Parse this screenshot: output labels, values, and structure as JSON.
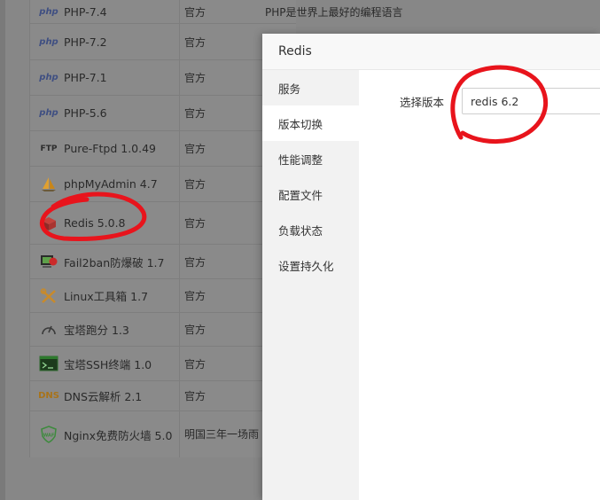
{
  "plugins": [
    {
      "name": "PHP-7.4",
      "type": "官方",
      "desc": "PHP是世界上最好的编程语言",
      "icon": "php-icon"
    },
    {
      "name": "PHP-7.2",
      "type": "官方",
      "desc": "",
      "icon": "php-icon"
    },
    {
      "name": "PHP-7.1",
      "type": "官方",
      "desc": "",
      "icon": "php-icon"
    },
    {
      "name": "PHP-5.6",
      "type": "官方",
      "desc": "",
      "icon": "php-icon"
    },
    {
      "name": "Pure-Ftpd 1.0.49",
      "type": "官方",
      "desc": "",
      "icon": "ftp-icon"
    },
    {
      "name": "phpMyAdmin 4.7",
      "type": "官方",
      "desc": "",
      "icon": "phpmyadmin-sailboat-icon"
    },
    {
      "name": "Redis 5.0.8",
      "type": "官方",
      "desc": "",
      "icon": "redis-cube-icon"
    },
    {
      "name": "Fail2ban防爆破 1.7",
      "type": "官方",
      "desc": "",
      "icon": "fail2ban-icon"
    },
    {
      "name": "Linux工具箱 1.7",
      "type": "官方",
      "desc": "",
      "icon": "tools-icon"
    },
    {
      "name": "宝塔跑分 1.3",
      "type": "官方",
      "desc": "",
      "icon": "gauge-icon"
    },
    {
      "name": "宝塔SSH终端 1.0",
      "type": "官方",
      "desc": "",
      "icon": "terminal-icon"
    },
    {
      "name": "DNS云解析 2.1",
      "type": "官方",
      "desc": "",
      "icon": "dns-icon"
    },
    {
      "name": "Nginx免费防火墙 5.0",
      "type": "明国三年一场雨",
      "desc": "",
      "icon": "waf-shield-icon"
    }
  ],
  "badges": {
    "php": "php",
    "ftp": "FTP",
    "dns": "DNS",
    "waf": "WAF"
  },
  "modal": {
    "title": "Redis",
    "menu": [
      "服务",
      "版本切换",
      "性能调整",
      "配置文件",
      "负载状态",
      "设置持久化"
    ],
    "active_index": 1,
    "version_label": "选择版本",
    "version_value": "redis 6.2"
  },
  "colors": {
    "annotation": "#e8141c",
    "overlay": "#878787"
  }
}
